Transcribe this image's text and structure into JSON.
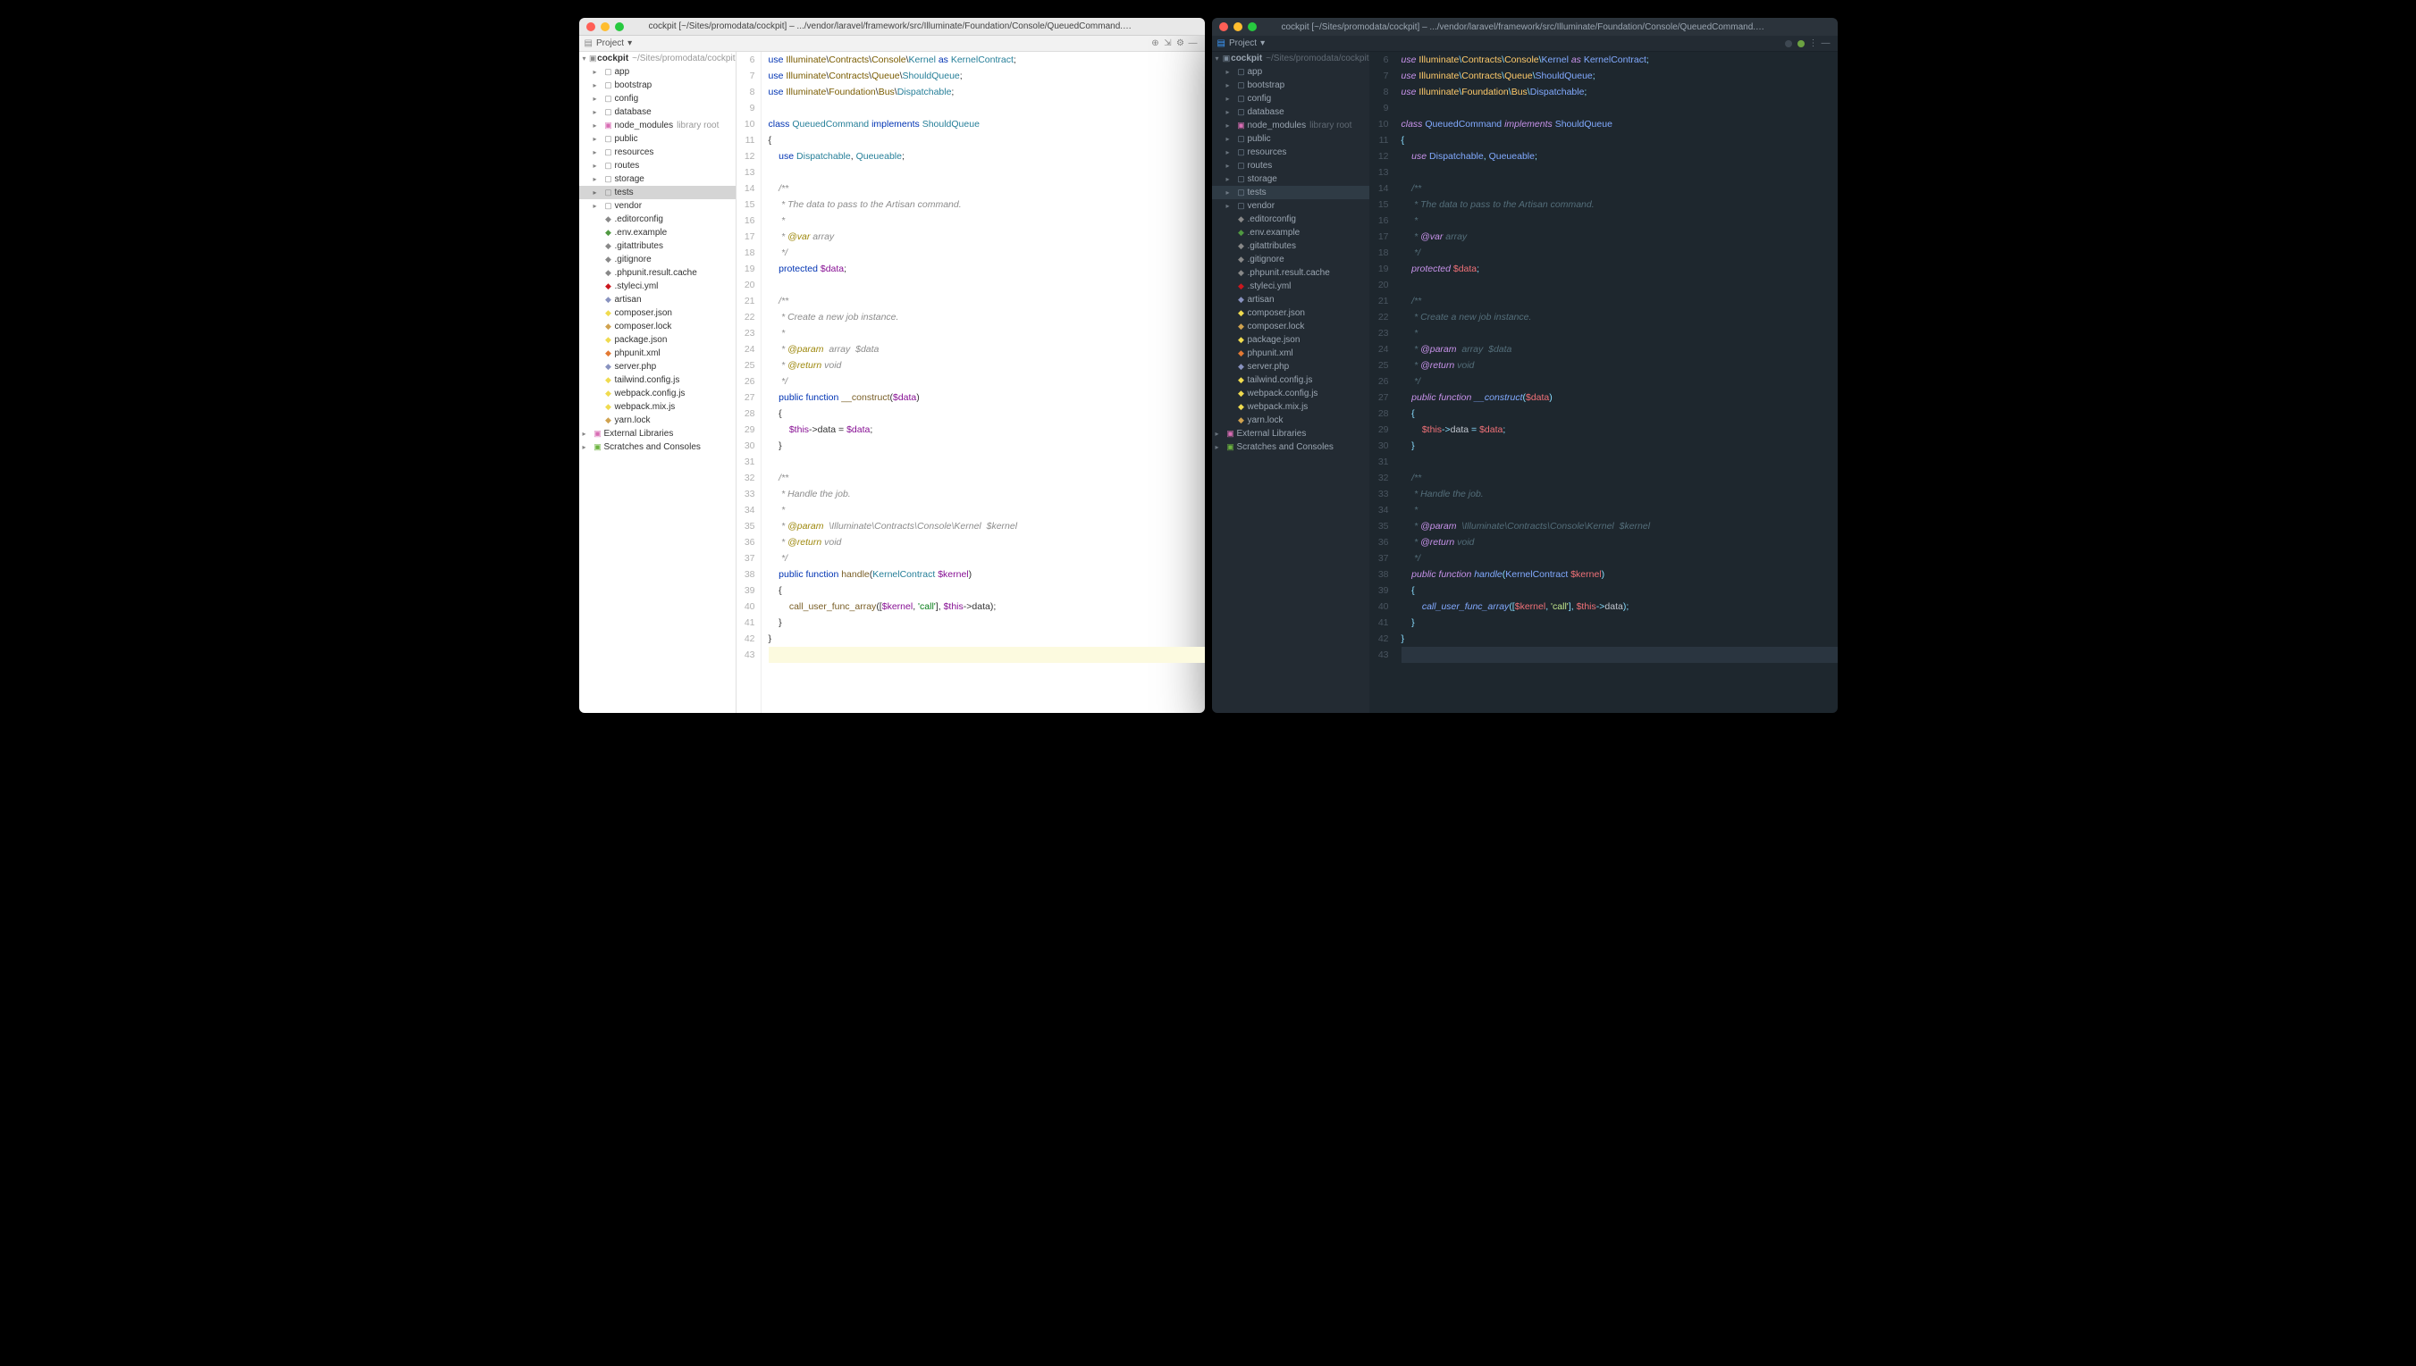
{
  "windowTitle": "cockpit [~/Sites/promodata/cockpit] – .../vendor/laravel/framework/src/Illuminate/Foundation/Console/QueuedCommand.php",
  "toolbar": {
    "projectLabel": "Project"
  },
  "tree": {
    "root": {
      "label": "cockpit",
      "hint": "~/Sites/promodata/cockpit"
    },
    "folders": [
      {
        "label": "app"
      },
      {
        "label": "bootstrap"
      },
      {
        "label": "config"
      },
      {
        "label": "database"
      },
      {
        "label": "node_modules",
        "hint": "library root",
        "lib": true
      },
      {
        "label": "public"
      },
      {
        "label": "resources"
      },
      {
        "label": "routes"
      },
      {
        "label": "storage"
      },
      {
        "label": "tests",
        "selected": true
      },
      {
        "label": "vendor"
      }
    ],
    "files": [
      {
        "label": ".editorconfig",
        "cls": "ico-txt"
      },
      {
        "label": ".env.example",
        "cls": "ico-env"
      },
      {
        "label": ".gitattributes",
        "cls": "ico-txt"
      },
      {
        "label": ".gitignore",
        "cls": "ico-txt"
      },
      {
        "label": ".phpunit.result.cache",
        "cls": "ico-txt"
      },
      {
        "label": ".styleci.yml",
        "cls": "ico-yml"
      },
      {
        "label": "artisan",
        "cls": "ico-php"
      },
      {
        "label": "composer.json",
        "cls": "ico-json"
      },
      {
        "label": "composer.lock",
        "cls": "ico-lock"
      },
      {
        "label": "package.json",
        "cls": "ico-json"
      },
      {
        "label": "phpunit.xml",
        "cls": "ico-xml"
      },
      {
        "label": "server.php",
        "cls": "ico-php"
      },
      {
        "label": "tailwind.config.js",
        "cls": "ico-js"
      },
      {
        "label": "webpack.config.js",
        "cls": "ico-js"
      },
      {
        "label": "webpack.mix.js",
        "cls": "ico-js"
      },
      {
        "label": "yarn.lock",
        "cls": "ico-lock"
      }
    ],
    "extras": [
      {
        "label": "External Libraries",
        "cls": "ico-lib"
      },
      {
        "label": "Scratches and Consoles",
        "cls": "ico-scratch"
      }
    ]
  },
  "code": {
    "startLine": 6,
    "lines": [
      [
        [
          "kw",
          "use "
        ],
        [
          "ns",
          "Illuminate"
        ],
        [
          "punc",
          "\\"
        ],
        [
          "ns",
          "Contracts"
        ],
        [
          "punc",
          "\\"
        ],
        [
          "ns",
          "Console"
        ],
        [
          "punc",
          "\\"
        ],
        [
          "cls",
          "Kernel"
        ],
        [
          "kw",
          " as "
        ],
        [
          "cls",
          "KernelContract"
        ],
        [
          "punc",
          ";"
        ]
      ],
      [
        [
          "kw",
          "use "
        ],
        [
          "ns",
          "Illuminate"
        ],
        [
          "punc",
          "\\"
        ],
        [
          "ns",
          "Contracts"
        ],
        [
          "punc",
          "\\"
        ],
        [
          "ns",
          "Queue"
        ],
        [
          "punc",
          "\\"
        ],
        [
          "cls",
          "ShouldQueue"
        ],
        [
          "punc",
          ";"
        ]
      ],
      [
        [
          "kw",
          "use "
        ],
        [
          "ns",
          "Illuminate"
        ],
        [
          "punc",
          "\\"
        ],
        [
          "ns",
          "Foundation"
        ],
        [
          "punc",
          "\\"
        ],
        [
          "ns",
          "Bus"
        ],
        [
          "punc",
          "\\"
        ],
        [
          "cls",
          "Dispatchable"
        ],
        [
          "punc",
          ";"
        ]
      ],
      [],
      [
        [
          "kw",
          "class "
        ],
        [
          "cls",
          "QueuedCommand"
        ],
        [
          "kw",
          " implements "
        ],
        [
          "cls",
          "ShouldQueue"
        ]
      ],
      [
        [
          "punc",
          "{"
        ]
      ],
      [
        [
          "",
          "    "
        ],
        [
          "kw",
          "use "
        ],
        [
          "cls",
          "Dispatchable"
        ],
        [
          "punc",
          ", "
        ],
        [
          "cls",
          "Queueable"
        ],
        [
          "punc",
          ";"
        ]
      ],
      [],
      [
        [
          "",
          "    "
        ],
        [
          "cm",
          "/**"
        ]
      ],
      [
        [
          "",
          "    "
        ],
        [
          "cm",
          " * The data to pass to the Artisan command."
        ]
      ],
      [
        [
          "",
          "    "
        ],
        [
          "cm",
          " *"
        ]
      ],
      [
        [
          "",
          "    "
        ],
        [
          "cm",
          " * "
        ],
        [
          "tag",
          "@var"
        ],
        [
          "cm",
          " array"
        ]
      ],
      [
        [
          "",
          "    "
        ],
        [
          "cm",
          " */"
        ]
      ],
      [
        [
          "",
          "    "
        ],
        [
          "kw",
          "protected "
        ],
        [
          "var",
          "$data"
        ],
        [
          "punc",
          ";"
        ]
      ],
      [],
      [
        [
          "",
          "    "
        ],
        [
          "cm",
          "/**"
        ]
      ],
      [
        [
          "",
          "    "
        ],
        [
          "cm",
          " * Create a new job instance."
        ]
      ],
      [
        [
          "",
          "    "
        ],
        [
          "cm",
          " *"
        ]
      ],
      [
        [
          "",
          "    "
        ],
        [
          "cm",
          " * "
        ],
        [
          "tag",
          "@param"
        ],
        [
          "cm",
          "  array  $data"
        ]
      ],
      [
        [
          "",
          "    "
        ],
        [
          "cm",
          " * "
        ],
        [
          "tag",
          "@return"
        ],
        [
          "cm",
          " void"
        ]
      ],
      [
        [
          "",
          "    "
        ],
        [
          "cm",
          " */"
        ]
      ],
      [
        [
          "",
          "    "
        ],
        [
          "kw",
          "public function "
        ],
        [
          "fn",
          "__construct"
        ],
        [
          "punc",
          "("
        ],
        [
          "var",
          "$data"
        ],
        [
          "punc",
          ")"
        ]
      ],
      [
        [
          "",
          "    "
        ],
        [
          "punc",
          "{"
        ]
      ],
      [
        [
          "",
          "        "
        ],
        [
          "var",
          "$this"
        ],
        [
          "punc",
          "->"
        ],
        [
          "",
          "data"
        ],
        [
          "punc",
          " = "
        ],
        [
          "var",
          "$data"
        ],
        [
          "punc",
          ";"
        ]
      ],
      [
        [
          "",
          "    "
        ],
        [
          "punc",
          "}"
        ]
      ],
      [],
      [
        [
          "",
          "    "
        ],
        [
          "cm",
          "/**"
        ]
      ],
      [
        [
          "",
          "    "
        ],
        [
          "cm",
          " * Handle the job."
        ]
      ],
      [
        [
          "",
          "    "
        ],
        [
          "cm",
          " *"
        ]
      ],
      [
        [
          "",
          "    "
        ],
        [
          "cm",
          " * "
        ],
        [
          "tag",
          "@param"
        ],
        [
          "cm",
          "  \\Illuminate\\Contracts\\Console\\Kernel  $kernel"
        ]
      ],
      [
        [
          "",
          "    "
        ],
        [
          "cm",
          " * "
        ],
        [
          "tag",
          "@return"
        ],
        [
          "cm",
          " void"
        ]
      ],
      [
        [
          "",
          "    "
        ],
        [
          "cm",
          " */"
        ]
      ],
      [
        [
          "",
          "    "
        ],
        [
          "kw",
          "public function "
        ],
        [
          "fn",
          "handle"
        ],
        [
          "punc",
          "("
        ],
        [
          "cls",
          "KernelContract "
        ],
        [
          "var",
          "$kernel"
        ],
        [
          "punc",
          ")"
        ]
      ],
      [
        [
          "",
          "    "
        ],
        [
          "punc",
          "{"
        ]
      ],
      [
        [
          "",
          "        "
        ],
        [
          "fn",
          "call_user_func_array"
        ],
        [
          "punc",
          "(["
        ],
        [
          "var",
          "$kernel"
        ],
        [
          "punc",
          ", "
        ],
        [
          "str",
          "'call'"
        ],
        [
          "punc",
          "], "
        ],
        [
          "var",
          "$this"
        ],
        [
          "punc",
          "->"
        ],
        [
          "",
          "data"
        ],
        [
          "punc",
          ");"
        ]
      ],
      [
        [
          "",
          "    "
        ],
        [
          "punc",
          "}"
        ]
      ],
      [
        [
          "punc",
          "}"
        ]
      ],
      []
    ],
    "currentLine": 43
  }
}
